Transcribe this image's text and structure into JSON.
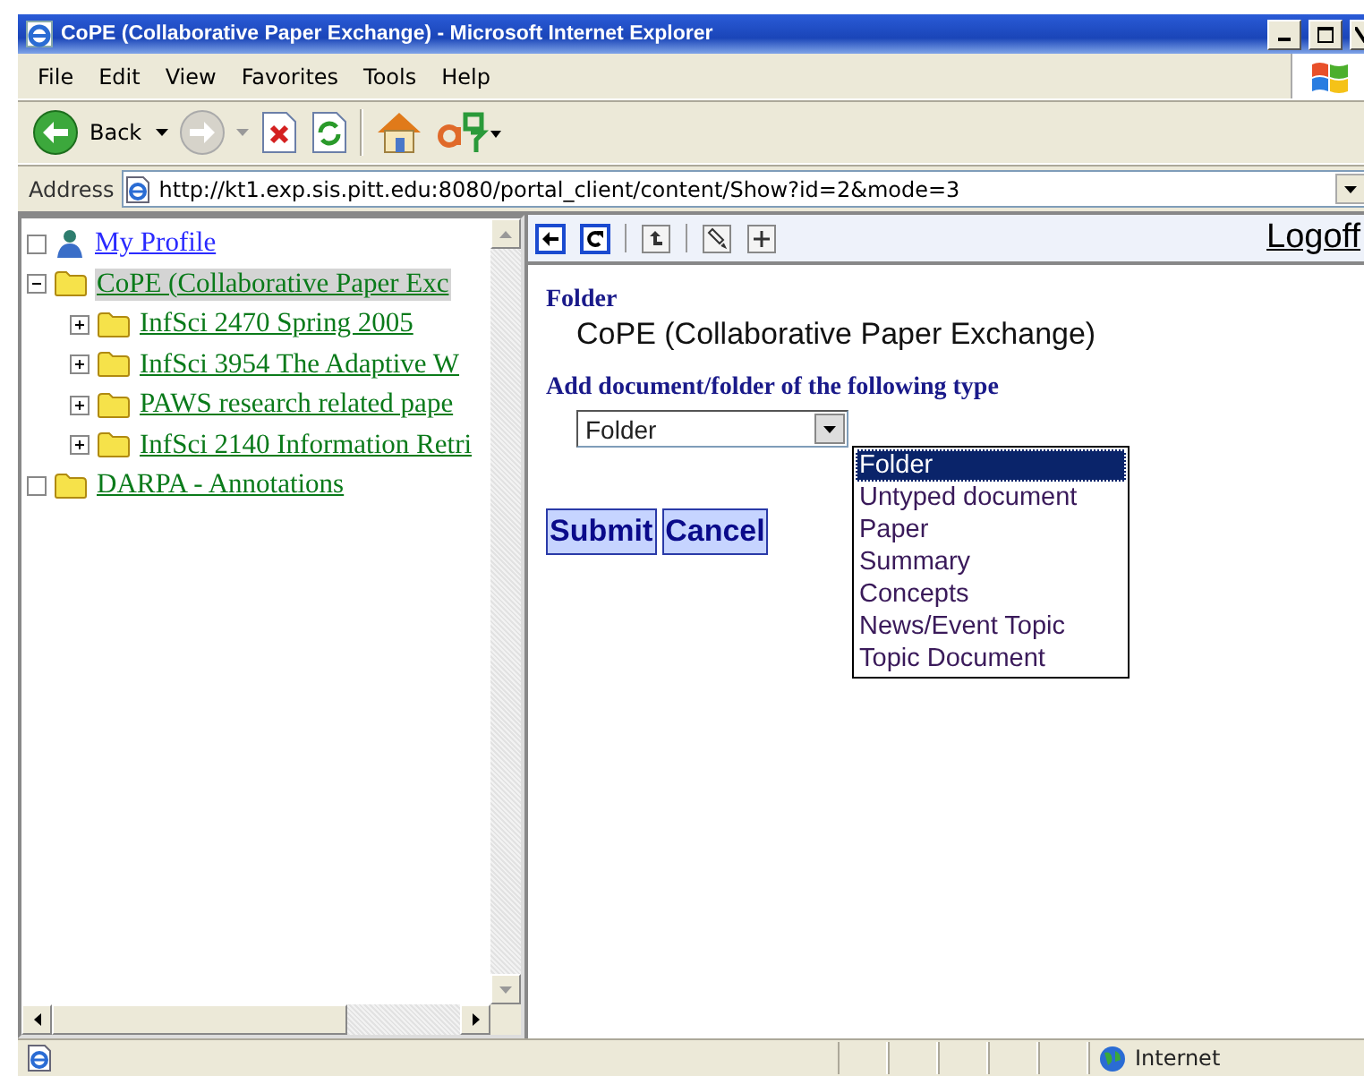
{
  "window": {
    "title": "CoPE (Collaborative Paper Exchange) - Microsoft Internet Explorer"
  },
  "menu": [
    "File",
    "Edit",
    "View",
    "Favorites",
    "Tools",
    "Help"
  ],
  "toolbar": {
    "back_label": "Back"
  },
  "address": {
    "label": "Address",
    "url": "http://kt1.exp.sis.pitt.edu:8080/portal_client/content/Show?id=2&mode=3"
  },
  "tree": [
    {
      "label": "My Profile",
      "kind": "profile",
      "selected": false,
      "checked": false
    },
    {
      "label": "CoPE (Collaborative Paper Exc",
      "kind": "folder",
      "selected": true,
      "expanded": true,
      "children": [
        {
          "label": "InfSci 2470 Spring 2005",
          "kind": "folder",
          "selected": false,
          "expanded": false
        },
        {
          "label": "InfSci 3954 The Adaptive W",
          "kind": "folder",
          "selected": false,
          "expanded": false
        },
        {
          "label": "PAWS research related pape",
          "kind": "folder",
          "selected": false,
          "expanded": false
        },
        {
          "label": "InfSci 2140 Information Retri",
          "kind": "folder",
          "selected": false,
          "expanded": false
        }
      ]
    },
    {
      "label": "DARPA - Annotations",
      "kind": "folder",
      "selected": false,
      "checked": false
    }
  ],
  "content": {
    "logoff": "Logoff",
    "folder_label": "Folder",
    "folder_name": "CoPE (Collaborative Paper Exchange)",
    "type_label": "Add document/folder of the following type",
    "type_select": {
      "value": "Folder",
      "expanded": true,
      "options": [
        {
          "label": "Folder",
          "selected": true
        },
        {
          "label": "Untyped document",
          "selected": false
        },
        {
          "label": "Paper",
          "selected": false
        },
        {
          "label": "Summary",
          "selected": false
        },
        {
          "label": "Concepts",
          "selected": false
        },
        {
          "label": "News/Event Topic",
          "selected": false
        },
        {
          "label": "Topic Document",
          "selected": false
        }
      ]
    },
    "buttons": [
      "Submit",
      "Cancel"
    ]
  },
  "status_bar": {
    "zone": "Internet"
  }
}
